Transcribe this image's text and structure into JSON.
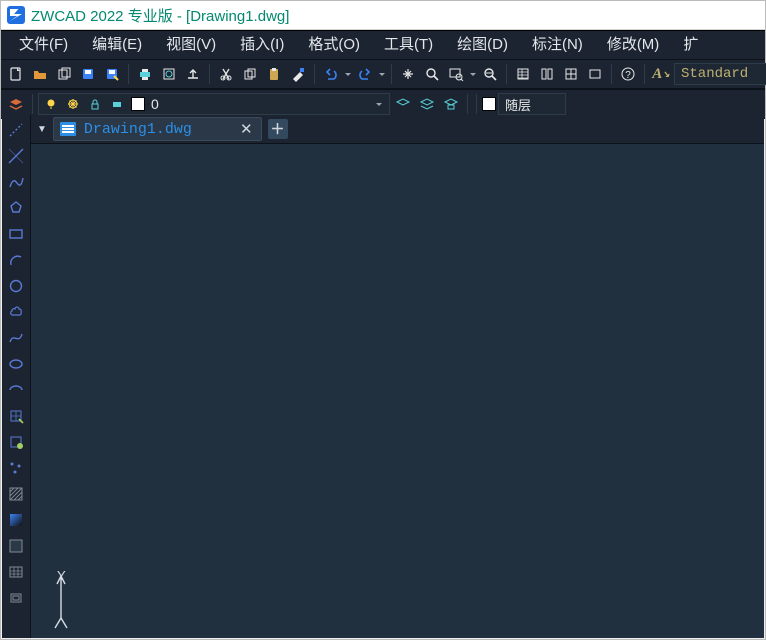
{
  "window": {
    "title": "ZWCAD 2022 专业版 - [Drawing1.dwg]"
  },
  "menu": {
    "items": [
      {
        "label": "文件(F)"
      },
      {
        "label": "编辑(E)"
      },
      {
        "label": "视图(V)"
      },
      {
        "label": "插入(I)"
      },
      {
        "label": "格式(O)"
      },
      {
        "label": "工具(T)"
      },
      {
        "label": "绘图(D)"
      },
      {
        "label": "标注(N)"
      },
      {
        "label": "修改(M)"
      },
      {
        "label": "扩"
      }
    ]
  },
  "toolbar1": {
    "newdoc": "new-document",
    "open": "open",
    "multi": "multi-docs",
    "save": "save",
    "saveas": "save-as",
    "print": "print",
    "preview": "print-preview",
    "publish": "publish",
    "cut": "cut",
    "copy": "copy",
    "paste": "paste",
    "matchprop": "match-properties",
    "undo": "undo",
    "redo": "redo",
    "pan": "pan",
    "zoomrt": "zoom-realtime",
    "zoomwin": "zoom-window",
    "zoomprev": "zoom-previous",
    "props": "properties-palette",
    "toolpal": "tool-palettes",
    "design": "design-center",
    "cleanscr": "clean-screen",
    "help": "help",
    "styleA": "text-style",
    "standard": "Standard"
  },
  "toolbar2": {
    "layerprops": "layer-properties",
    "layer_current": "0",
    "layer_psel": "随层",
    "layer_pip_bulb": "layer-on",
    "layer_pip_freeze": "layer-freeze",
    "layer_pip_lock": "layer-lock",
    "layer_pip_color": "layer-color"
  },
  "tabs": {
    "active_tab_label": "Drawing1.dwg"
  },
  "left_tools": [
    "line",
    "construction-line",
    "polyline",
    "polygon",
    "rectangle",
    "arc",
    "circle",
    "revision-cloud",
    "spline",
    "ellipse",
    "ellipse-arc",
    "block-insert",
    "make-block",
    "point",
    "hatch",
    "gradient",
    "region",
    "table",
    "donut"
  ],
  "axis": {
    "y_label": "Y"
  }
}
